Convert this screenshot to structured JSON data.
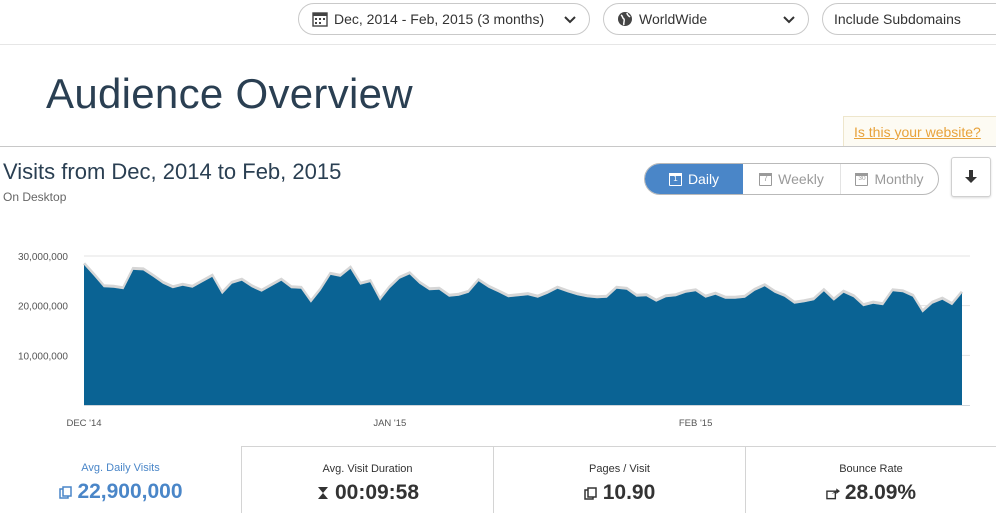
{
  "filters": {
    "date_range": "Dec, 2014 - Feb, 2015 (3 months)",
    "country": "WorldWide",
    "subdomains": "Include Subdomains"
  },
  "page_title": "Audience Overview",
  "claim_link": "Is this your website?",
  "section": {
    "title": "Visits from Dec, 2014 to Feb, 2015",
    "subtitle": "On Desktop"
  },
  "granularity": {
    "options": [
      {
        "label": "Daily",
        "icon_text": "1"
      },
      {
        "label": "Weekly",
        "icon_text": "7"
      },
      {
        "label": "Monthly",
        "icon_text": "30"
      }
    ],
    "selected": "Daily"
  },
  "icons": {
    "date": "calendar-icon",
    "country": "globe-icon",
    "dropdown": "chevron-down-icon",
    "download": "download-icon"
  },
  "colors": {
    "area_fill": "#0a6394",
    "area_outline": "#d6d6d6",
    "accent": "#4a86c8",
    "link": "#e8a23a"
  },
  "chart_data": {
    "type": "area",
    "xlabel": "",
    "ylabel": "",
    "ylim": [
      0,
      30000000
    ],
    "y_ticks": [
      "30,000,000",
      "20,000,000",
      "10,000,000"
    ],
    "y_tick_values": [
      30000000,
      20000000,
      10000000
    ],
    "x_ticks": [
      "DEC '14",
      "JAN '15",
      "FEB '15"
    ],
    "x_tick_day_index": [
      0,
      31,
      62
    ],
    "grid": true,
    "series": [
      {
        "values": [
          28200000,
          26000000,
          23700000,
          23600000,
          23300000,
          27200000,
          27100000,
          25800000,
          24400000,
          23500000,
          24000000,
          23600000,
          24700000,
          25800000,
          22300000,
          24400000,
          25000000,
          23700000,
          22800000,
          23900000,
          25000000,
          23500000,
          23400000,
          20600000,
          23100000,
          26200000,
          25800000,
          27400000,
          24200000,
          24700000,
          21000000,
          23500000,
          25400000,
          26300000,
          24400000,
          23100000,
          23200000,
          21800000,
          22000000,
          22600000,
          24900000,
          23600000,
          22700000,
          21700000,
          21900000,
          22100000,
          21600000,
          22400000,
          23400000,
          22700000,
          22100000,
          21700000,
          21500000,
          21600000,
          23400000,
          23200000,
          21800000,
          21900000,
          20800000,
          21700000,
          21900000,
          22600000,
          22900000,
          21600000,
          22200000,
          21400000,
          21400000,
          21600000,
          23000000,
          23900000,
          22600000,
          21800000,
          20400000,
          20700000,
          21100000,
          22900000,
          21000000,
          22600000,
          21700000,
          19900000,
          20400000,
          20100000,
          22900000,
          22700000,
          21800000,
          18600000,
          20400000,
          21200000,
          20100000,
          22500000
        ]
      }
    ],
    "x_start": "2014-12-01",
    "x_end": "2015-02-28"
  },
  "metrics": [
    {
      "label": "Avg. Daily Visits",
      "value": "22,900,000",
      "icon": "copy-icon"
    },
    {
      "label": "Avg. Visit Duration",
      "value": "00:09:58",
      "icon": "hourglass-icon"
    },
    {
      "label": "Pages / Visit",
      "value": "10.90",
      "icon": "copy-icon"
    },
    {
      "label": "Bounce Rate",
      "value": "28.09%",
      "icon": "share-icon"
    }
  ]
}
